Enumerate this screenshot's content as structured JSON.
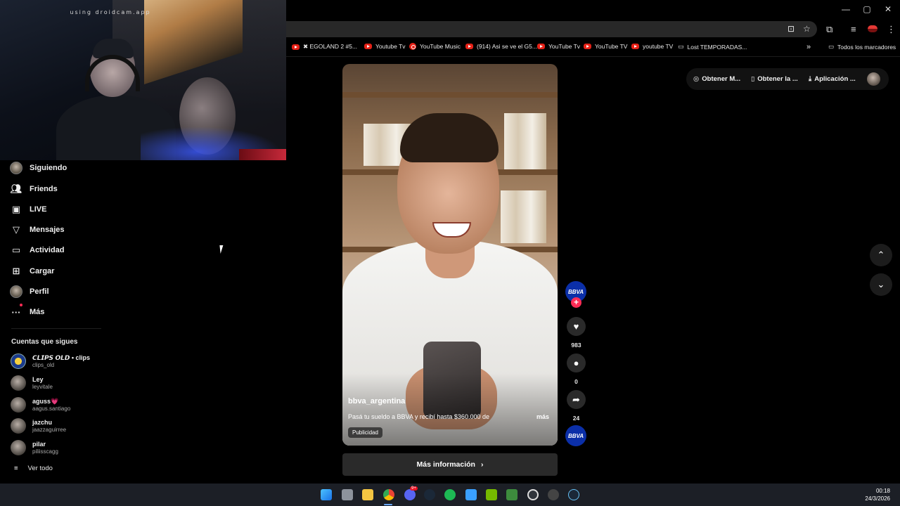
{
  "webcam": {
    "watermark": "using droidcam.app"
  },
  "browser": {
    "window_controls": [
      "—",
      "▢",
      "✕"
    ],
    "toolbar_icons": [
      "install-icon",
      "star-icon",
      "extensions-icon",
      "media-icon",
      "profile-icon",
      "menu-icon"
    ],
    "bookmarks": [
      {
        "label": "✖ EGOLAND 2 #5...",
        "icon": "youtube"
      },
      {
        "label": "Youtube Tv",
        "icon": "youtube"
      },
      {
        "label": "YouTube Music",
        "icon": "youtube-music"
      },
      {
        "label": "(914) Asi se ve el G5...",
        "icon": "youtube"
      },
      {
        "label": "YouTube Tv",
        "icon": "youtube"
      },
      {
        "label": "YouTube TV",
        "icon": "youtube"
      },
      {
        "label": "youtube TV",
        "icon": "youtube"
      },
      {
        "label": "Lost TEMPORADAS...",
        "icon": "page"
      }
    ],
    "bookmarks_overflow": "»",
    "all_bookmarks": "Todos los marcadores"
  },
  "sidebar": {
    "nav": [
      {
        "label": "Siguiendo",
        "icon": "avatar"
      },
      {
        "label": "Friends",
        "icon": "friends-icon"
      },
      {
        "label": "LIVE",
        "icon": "live-icon"
      },
      {
        "label": "Mensajes",
        "icon": "messages-icon"
      },
      {
        "label": "Actividad",
        "icon": "activity-icon"
      },
      {
        "label": "Cargar",
        "icon": "upload-icon"
      },
      {
        "label": "Perfil",
        "icon": "avatar"
      },
      {
        "label": "Más",
        "icon": "more-icon"
      }
    ],
    "following_title": "Cuentas que sigues",
    "accounts": [
      {
        "name": "𝘾𝙇𝙄𝙋𝙎 𝙊𝙇𝘿 • clips",
        "handle": "clips_old"
      },
      {
        "name": "Ley",
        "handle": "leyvitale"
      },
      {
        "name": "aguss💗",
        "handle": "aagus.santiago"
      },
      {
        "name": "jazchu",
        "handle": "jaazzaguirree"
      },
      {
        "name": "pilar",
        "handle": "piliisscagg"
      }
    ],
    "see_all": "Ver todo"
  },
  "video": {
    "username": "bbva_argentina",
    "description": "Pasá tu sueldo a BBVA y recibí hasta $360.000 de",
    "more": "más",
    "badge": "Publicidad",
    "more_info": "Más información",
    "brand": "BBVA"
  },
  "actions": {
    "likes": "983",
    "comments": "0",
    "shares": "24"
  },
  "topright": {
    "items": [
      "Obtener M...",
      "Obtener la ...",
      "Aplicación ..."
    ]
  },
  "taskbar": {
    "time": "00:18",
    "date": "24/3/2026",
    "discord_badge": "9+"
  }
}
